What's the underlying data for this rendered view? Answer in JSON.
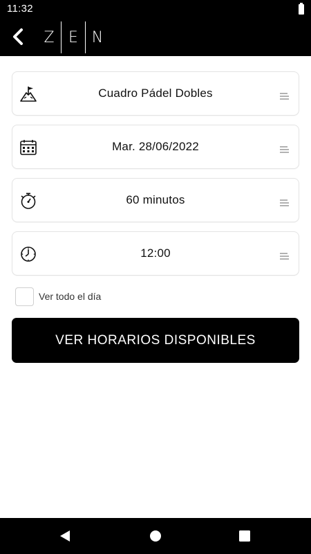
{
  "status_bar": {
    "time": "11:32",
    "battery_icon": "battery-full-icon"
  },
  "app_bar": {
    "back_icon": "chevron-left-icon",
    "logo_letters": [
      "Z",
      "E",
      "N"
    ]
  },
  "form": {
    "fields": [
      {
        "icon": "court-flag-icon",
        "value": "Cuadro Pádel Dobles",
        "menu_icon": "menu-lines-icon"
      },
      {
        "icon": "calendar-icon",
        "value": "Mar. 28/06/2022",
        "menu_icon": "menu-lines-icon"
      },
      {
        "icon": "stopwatch-icon",
        "value": "60 minutos",
        "menu_icon": "menu-lines-icon"
      },
      {
        "icon": "clock-icon",
        "value": "12:00",
        "menu_icon": "menu-lines-icon"
      }
    ],
    "all_day": {
      "label": "Ver todo el día",
      "checked": false
    },
    "submit_label": "VER HORARIOS DISPONIBLES"
  },
  "nav_bar": {
    "back_icon": "triangle-back-icon",
    "home_icon": "circle-home-icon",
    "recents_icon": "square-recents-icon"
  },
  "colors": {
    "bar": "#000000",
    "card_border": "#e3e3e3",
    "button": "#000000",
    "text": "#111111"
  }
}
